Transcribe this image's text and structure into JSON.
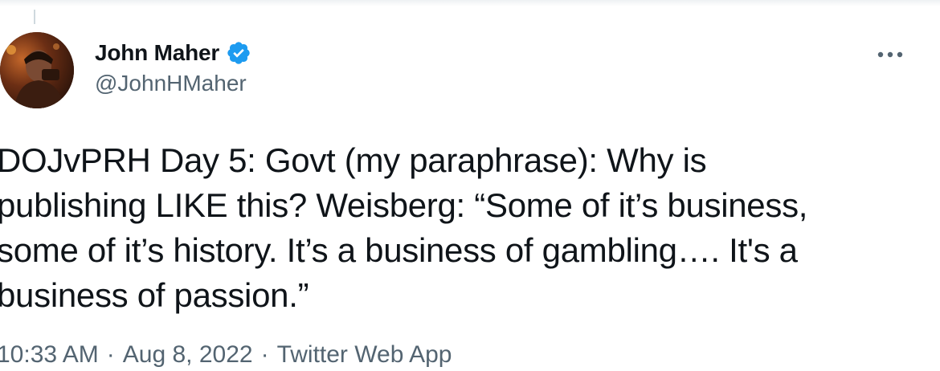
{
  "tweet": {
    "author": {
      "display_name": "John Maher",
      "handle": "@JohnHMaher",
      "verified": true,
      "avatar_icon": "profile-photo"
    },
    "text_lines": [
      "DOJvPRH Day 5: Govt (my paraphrase): Why is",
      "publishing LIKE this? Weisberg: “Some of it’s business,",
      "some of it’s history. It’s a business of gambling…. It's a",
      "business of passion.”"
    ],
    "meta": {
      "time": "10:33 AM",
      "separator": "·",
      "date": "Aug 8, 2022",
      "source": "Twitter Web App"
    },
    "more_icon": "more-options-icon"
  },
  "colors": {
    "text_primary": "#0f1419",
    "text_secondary": "#536471",
    "verified_blue": "#1d9bf0"
  }
}
